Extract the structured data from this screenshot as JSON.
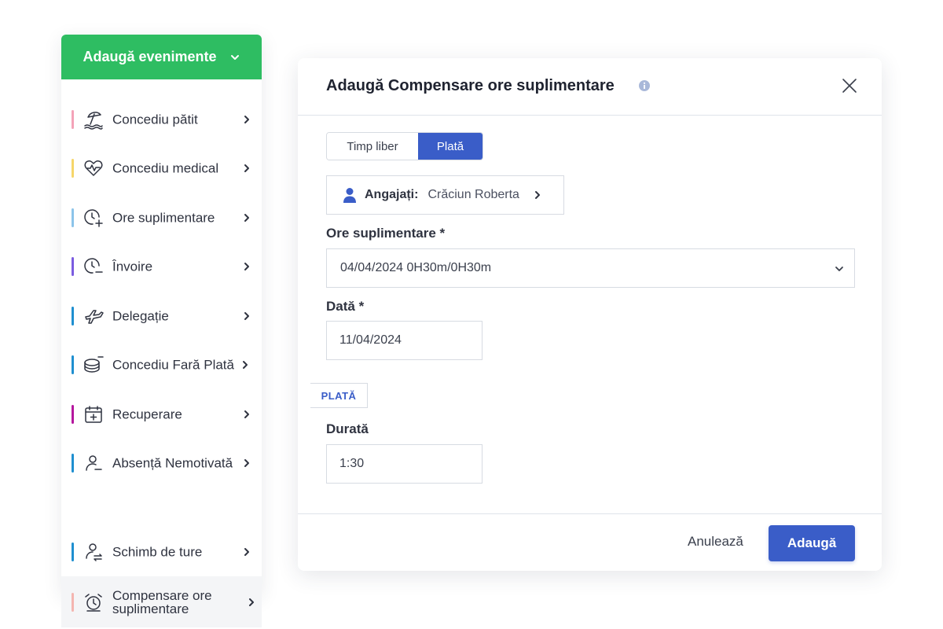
{
  "sidebar": {
    "header_label": "Adaugă evenimente",
    "items": [
      {
        "label": "Concediu pătit",
        "icon": "beach-umbrella-icon",
        "accent": "#f4a3b8"
      },
      {
        "label": "Concediu medical",
        "icon": "heart-pulse-icon",
        "accent": "#f6d66a"
      },
      {
        "label": "Ore suplimentare",
        "icon": "clock-plus-icon",
        "accent": "#8cc4ea"
      },
      {
        "label": "Învoire",
        "icon": "clock-minus-icon",
        "accent": "#7b5ce0"
      },
      {
        "label": "Delegație",
        "icon": "airplane-icon",
        "accent": "#1f8fd0"
      },
      {
        "label": "Concediu Fară Plată",
        "icon": "coins-minus-icon",
        "accent": "#1f8fd0"
      },
      {
        "label": "Recuperare",
        "icon": "calendar-plus-icon",
        "accent": "#b5179e"
      },
      {
        "label": "Absență Nemotivată",
        "icon": "user-minus-icon",
        "accent": "#1f8fd0"
      },
      {
        "label": "Schimb de ture",
        "icon": "user-swap-icon",
        "accent": "#1f8fd0"
      },
      {
        "label": "Compensare ore suplimentare",
        "icon": "alarm-clock-icon",
        "accent": "#f4b5b0"
      }
    ]
  },
  "modal": {
    "title": "Adaugă Compensare ore suplimentare",
    "tabs": {
      "free_time": "Timp liber",
      "payment": "Plată"
    },
    "active_tab": "Plată",
    "employees_label": "Angajați:",
    "employees_value": "Crăciun Roberta",
    "overtime_label": "Ore suplimentare *",
    "overtime_value": "04/04/2024 0H30m/0H30m",
    "date_label": "Dată *",
    "date_value": "11/04/2024",
    "section_tag": "PLATĂ",
    "duration_label": "Durată",
    "duration_value": "1:30",
    "cancel_label": "Anulează",
    "add_label": "Adaugă"
  },
  "colors": {
    "green": "#2ebd62",
    "blue": "#3a5dc8"
  }
}
